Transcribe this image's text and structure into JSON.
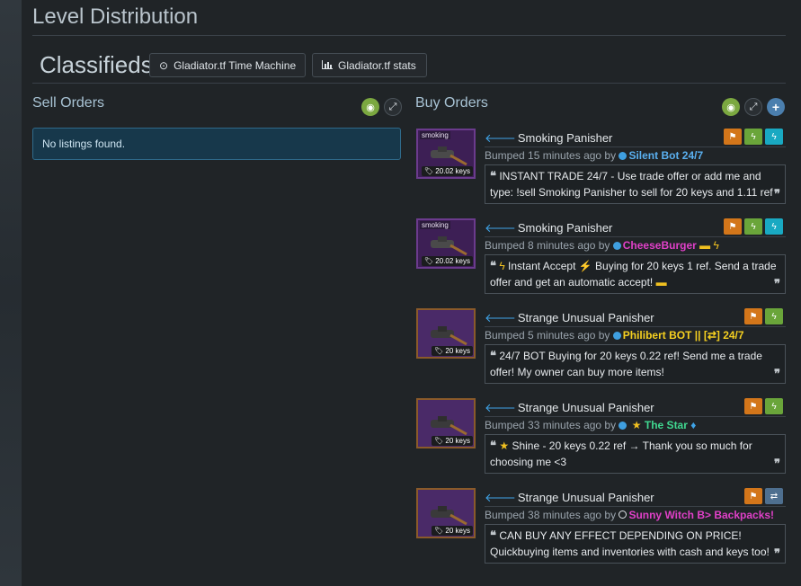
{
  "page": {
    "level_title": "Level Distribution",
    "classifieds_title": "Classifieds",
    "buttons": {
      "time_machine": "Gladiator.tf Time Machine",
      "stats": "Gladiator.tf stats"
    }
  },
  "sell": {
    "title": "Sell Orders",
    "empty_text": "No listings found."
  },
  "buy": {
    "title": "Buy Orders",
    "listings": [
      {
        "name": "Smoking Panisher",
        "tag": "smoking",
        "price": "20.02 keys",
        "bumped": "Bumped 15 minutes ago by",
        "user": "Silent Bot 24/7",
        "message": "INSTANT TRADE 24/7 - Use trade offer or add me and type: !sell Smoking Panisher to sell for 20 keys and 1.11 ref"
      },
      {
        "name": "Smoking Panisher",
        "tag": "smoking",
        "price": "20.02 keys",
        "bumped": "Bumped 8 minutes ago by",
        "user": "CheeseBurger",
        "message": "Instant Accept ⚡ Buying for 20 keys 1 ref. Send a trade offer and get an automatic accept!"
      },
      {
        "name": "Strange Unusual Panisher",
        "tag": "",
        "price": "20 keys",
        "bumped": "Bumped 5 minutes ago by",
        "user": "Philibert BOT || [⇄] 24/7",
        "message": "24/7 BOT Buying for 20 keys 0.22 ref! Send me a trade offer! My owner can buy more items!"
      },
      {
        "name": "Strange Unusual Panisher",
        "tag": "",
        "price": "20 keys",
        "bumped": "Bumped 33 minutes ago by",
        "user": "The Star",
        "message": "Shine - 20 keys 0.22 ref → Thank you so much for choosing me <3"
      },
      {
        "name": "Strange Unusual Panisher",
        "tag": "",
        "price": "20 keys",
        "bumped": "Bumped 38 minutes ago by",
        "user": "Sunny Witch B> Backpacks!",
        "message": "CAN BUY ANY EFFECT DEPENDING ON PRICE! Quickbuying items and inventories with cash and keys too!"
      }
    ]
  },
  "colors": {
    "user_silent": "#5ab0f0",
    "user_cheese": "#e040c8",
    "user_philibert": "#f5d020",
    "user_star": "#40d890",
    "user_sunny": "#e040c8",
    "accent_blue": "#3fa4e8"
  },
  "icons": [
    "clock-icon",
    "bar-chart-icon",
    "eye-slash-icon",
    "expand-icon",
    "plus-icon",
    "flag-icon",
    "lightning-icon",
    "swap-icon",
    "quote-icon",
    "tag-icon",
    "arrow-left-icon"
  ]
}
